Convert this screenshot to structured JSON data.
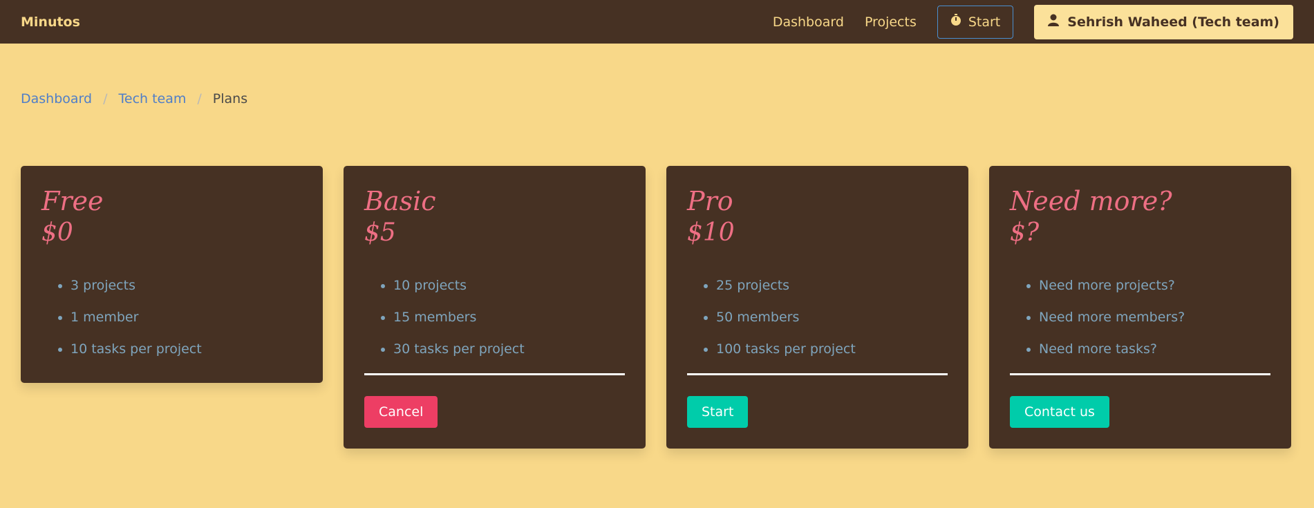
{
  "header": {
    "brand": "Minutos",
    "nav": [
      "Dashboard",
      "Projects"
    ],
    "start_label": "Start",
    "user_label": "Sehrish Waheed (Tech team)"
  },
  "breadcrumb": {
    "items": [
      "Dashboard",
      "Tech team"
    ],
    "current": "Plans"
  },
  "plans": [
    {
      "name": "Free",
      "price": "$0",
      "features": [
        "3 projects",
        "1 member",
        "10 tasks per project"
      ]
    },
    {
      "name": "Basic",
      "price": "$5",
      "features": [
        "10 projects",
        "15 members",
        "30 tasks per project"
      ],
      "button": "Cancel"
    },
    {
      "name": "Pro",
      "price": "$10",
      "features": [
        "25 projects",
        "50 members",
        "100 tasks per project"
      ],
      "button": "Start"
    },
    {
      "name": "Need more?",
      "price": "$?",
      "features": [
        "Need more projects?",
        "Need more members?",
        "Need more tasks?"
      ],
      "button": "Contact us"
    }
  ],
  "colors": {
    "navbar": "#463123",
    "background": "#f8d889",
    "accent_pink": "#ee6f84",
    "cancel": "#ed3e64",
    "action": "#00ccaa"
  }
}
